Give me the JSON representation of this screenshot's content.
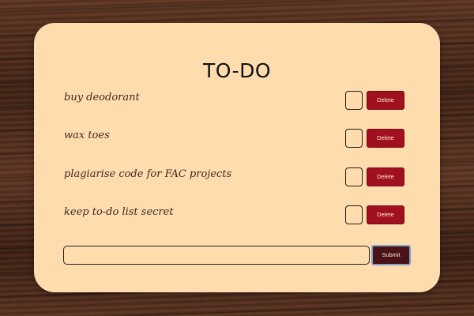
{
  "app": {
    "title": "TO-DO"
  },
  "todos": [
    {
      "text": "buy deodorant",
      "checked": false,
      "delete_label": "Delete"
    },
    {
      "text": "wax toes",
      "checked": false,
      "delete_label": "Delete"
    },
    {
      "text": "plagiarise code for FAC projects",
      "checked": false,
      "delete_label": "Delete"
    },
    {
      "text": "keep to-do list secret",
      "checked": false,
      "delete_label": "Delete"
    }
  ],
  "form": {
    "input_value": "",
    "input_placeholder": "",
    "submit_label": "Submit"
  },
  "colors": {
    "card_background": "#ffdcad",
    "delete_button": "#a0101e",
    "submit_button": "#4a1116",
    "submit_focus_ring": "#7fa2c9"
  }
}
